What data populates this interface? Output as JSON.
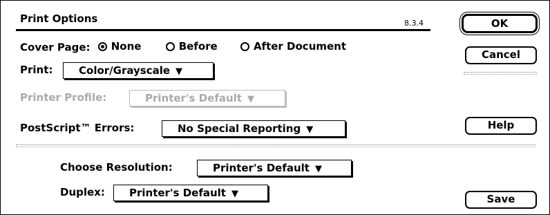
{
  "dialog": {
    "title": "Print Options",
    "version": "8.3.4"
  },
  "cover_page": {
    "label": "Cover Page:",
    "options": [
      {
        "label": "None",
        "selected": true
      },
      {
        "label": "Before",
        "selected": false
      },
      {
        "label": "After Document",
        "selected": false
      }
    ]
  },
  "print": {
    "label": "Print:",
    "value": "Color/Grayscale"
  },
  "printer_profile": {
    "label": "Printer Profile:",
    "value": "Printer's Default",
    "enabled": false
  },
  "postscript_errors": {
    "label": "PostScript™ Errors:",
    "value": "No Special Reporting"
  },
  "resolution": {
    "label": "Choose Resolution:",
    "value": "Printer's Default"
  },
  "duplex": {
    "label": "Duplex:",
    "value": "Printer's Default"
  },
  "buttons": {
    "ok": "OK",
    "cancel": "Cancel",
    "help": "Help",
    "save": "Save"
  },
  "icons": {
    "popup_arrow": "▼"
  }
}
